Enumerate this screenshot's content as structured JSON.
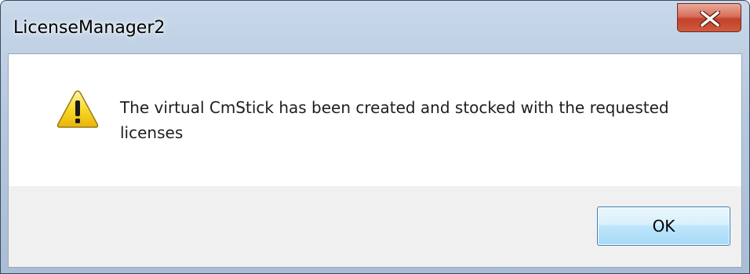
{
  "window": {
    "title": "LicenseManager2"
  },
  "message": {
    "text": "The virtual CmStick has been created and stocked with the requested licenses",
    "icon": "warning-icon"
  },
  "buttons": {
    "ok_label": "OK",
    "close_icon": "close-icon"
  },
  "colors": {
    "close_button": "#c2412a",
    "ok_button_border": "#3c7fb1",
    "button_area_bg": "#f0f0f0",
    "warning_yellow": "#f5d21b"
  }
}
